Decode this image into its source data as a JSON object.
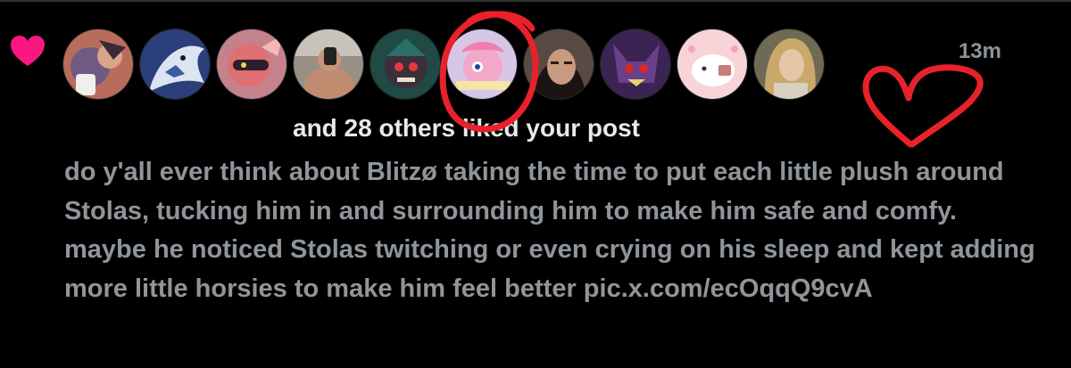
{
  "notification": {
    "type_icon": "heart-icon",
    "summary": "and 28 others liked your post",
    "timestamp": "13m",
    "post": {
      "text": "do y'all ever think about Blitzø taking the time to put each little plush around Stolas, tucking him in and surrounding him to make him safe and comfy. maybe he noticed Stolas twitching or even crying on his sleep and kept adding more little horsies to make him feel better",
      "link": "pic.x.com/ecOqqQ9cvA"
    },
    "avatars": [
      {
        "name": "avatar-1"
      },
      {
        "name": "avatar-2"
      },
      {
        "name": "avatar-3"
      },
      {
        "name": "avatar-4"
      },
      {
        "name": "avatar-5"
      },
      {
        "name": "avatar-6"
      },
      {
        "name": "avatar-7"
      },
      {
        "name": "avatar-8"
      },
      {
        "name": "avatar-9"
      },
      {
        "name": "avatar-10"
      }
    ]
  },
  "colors": {
    "background": "#000000",
    "like_pink": "#f91880",
    "annotation_red": "#e8222a",
    "secondary_text": "#8f959a",
    "primary_text": "#e7e9ea"
  }
}
